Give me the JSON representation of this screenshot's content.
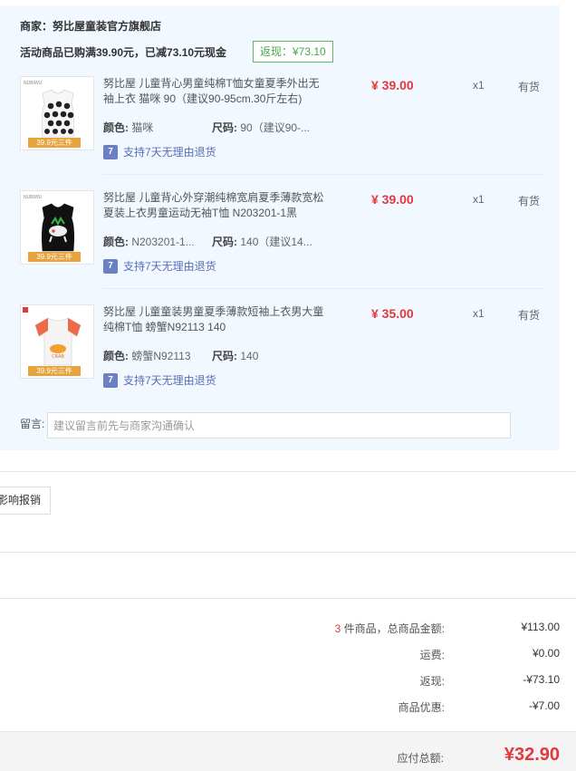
{
  "shop": {
    "name": "商家：努比屋童装官方旗舰店",
    "promo": "活动商品已购满39.90元，已减73.10元现金",
    "rebate_tag": "返现：¥73.10"
  },
  "items": [
    {
      "title": "努比屋 儿童背心男童纯棉T恤女童夏季外出无袖上衣 猫咪 90（建议90-95cm.30斤左右)",
      "price": "¥ 39.00",
      "qty": "x1",
      "stock": "有货",
      "color_label": "颜色:",
      "color": "猫咪",
      "size_label": "尺码:",
      "size": "90（建议90-...",
      "return": "支持7天无理由退货",
      "thumb_brand": "NUBIWU",
      "thumb_badge": "39.9元三件"
    },
    {
      "title": "努比屋 儿童背心外穿潮纯棉宽肩夏季薄款宽松夏装上衣男童运动无袖T恤 N203201-1黑",
      "price": "¥ 39.00",
      "qty": "x1",
      "stock": "有货",
      "color_label": "颜色:",
      "color": "N203201-1...",
      "size_label": "尺码:",
      "size": "140（建议14...",
      "return": "支持7天无理由退货",
      "thumb_brand": "NUBIWU",
      "thumb_badge": "39.9元三件"
    },
    {
      "title": "努比屋 儿童童装男童夏季薄款短袖上衣男大童纯棉T恤 螃蟹N92113 140",
      "price": "¥ 35.00",
      "qty": "x1",
      "stock": "有货",
      "color_label": "颜色:",
      "color": "螃蟹N92113",
      "size_label": "尺码:",
      "size": "140",
      "return": "支持7天无理由退货",
      "thumb_brand": "",
      "thumb_badge": "39.9元三件"
    }
  ],
  "message": {
    "label": "留言:",
    "placeholder": "建议留言前先与商家沟通确认"
  },
  "invoice_button": "影响报销",
  "summary": {
    "count": "3",
    "count_suffix": " 件商品，总商品金额:",
    "goods_total": "¥113.00",
    "shipping_label": "运费:",
    "shipping": "¥0.00",
    "rebate_label": "返现:",
    "rebate": "-¥73.10",
    "discount_label": "商品优惠:",
    "discount": "-¥7.00",
    "total_label": "应付总额:",
    "total": "¥32.90"
  },
  "colors": {
    "accent_red": "#e4393c",
    "shop_bg": "#f1f8ff",
    "rebate_green": "#5cb85c",
    "link_blue": "#5a6fb7"
  },
  "icons": {
    "return_policy": "return-7day-icon"
  }
}
